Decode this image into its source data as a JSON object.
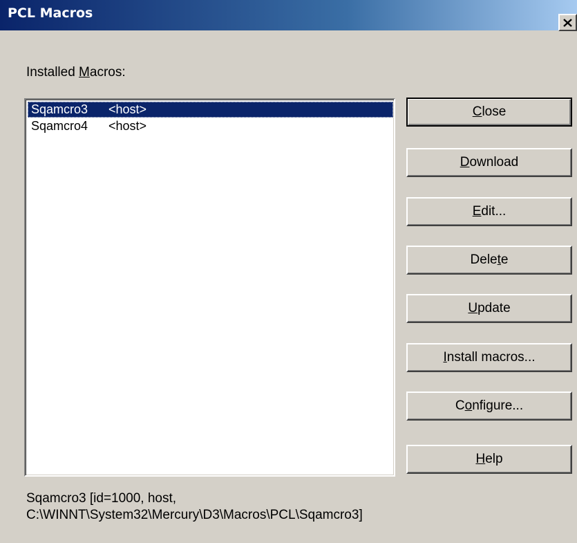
{
  "window": {
    "title": "PCL Macros"
  },
  "installed_label": {
    "pre": "Installed ",
    "key": "M",
    "post": "acros:"
  },
  "macros": [
    {
      "name": "Sqamcro3",
      "source": "<host>",
      "selected": true
    },
    {
      "name": "Sqamcro4",
      "source": "<host>",
      "selected": false
    }
  ],
  "buttons": {
    "close": {
      "pre": "",
      "key": "C",
      "post": "lose"
    },
    "download": {
      "pre": "",
      "key": "D",
      "post": "ownload"
    },
    "edit": {
      "pre": "",
      "key": "E",
      "post": "dit..."
    },
    "delete": {
      "pre": "Dele",
      "key": "t",
      "post": "e"
    },
    "update": {
      "pre": "",
      "key": "U",
      "post": "pdate"
    },
    "install": {
      "pre": "",
      "key": "I",
      "post": "nstall macros..."
    },
    "configure": {
      "pre": "C",
      "key": "o",
      "post": "nfigure..."
    },
    "help": {
      "pre": "",
      "key": "H",
      "post": "elp"
    }
  },
  "status": {
    "line1": "Sqamcro3 [id=1000, host,",
    "line2": "C:\\WINNT\\System32\\Mercury\\D3\\Macros\\PCL\\Sqamcro3]"
  },
  "colors": {
    "titlebar_start": "#0a246a",
    "titlebar_end": "#a6caf0",
    "selection": "#0a246a",
    "face": "#d4d0c8"
  }
}
